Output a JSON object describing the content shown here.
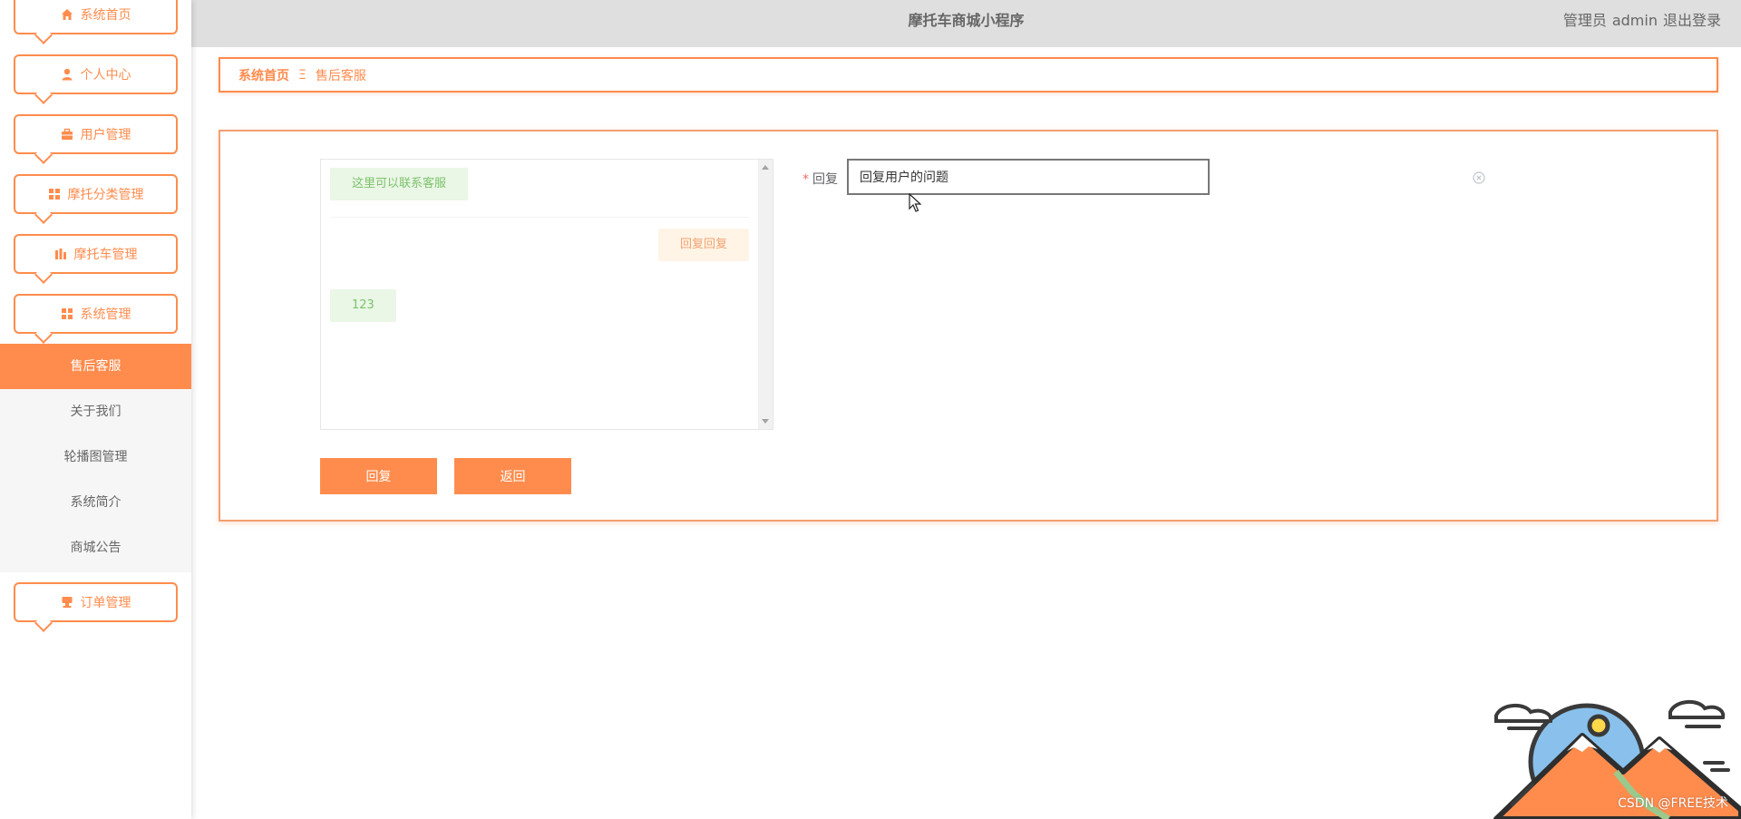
{
  "app": {
    "title": "摩托车商城小程序",
    "user_role": "管理员",
    "user_name": "admin",
    "logout_label": "退出登录"
  },
  "sidebar": {
    "menus": [
      {
        "label": "系统首页",
        "icon": "home-icon"
      },
      {
        "label": "个人中心",
        "icon": "user-icon"
      },
      {
        "label": "用户管理",
        "icon": "briefcase-icon"
      },
      {
        "label": "摩托分类管理",
        "icon": "grid-icon"
      },
      {
        "label": "摩托车管理",
        "icon": "chart-icon"
      },
      {
        "label": "系统管理",
        "icon": "grid-icon"
      },
      {
        "label": "订单管理",
        "icon": "stamp-icon"
      }
    ],
    "submenu": [
      {
        "label": "售后客服",
        "active": true
      },
      {
        "label": "关于我们",
        "active": false
      },
      {
        "label": "轮播图管理",
        "active": false
      },
      {
        "label": "系统简介",
        "active": false
      },
      {
        "label": "商城公告",
        "active": false
      }
    ]
  },
  "breadcrumb": {
    "home": "系统首页",
    "separator": "Ξ",
    "current": "售后客服"
  },
  "chat": {
    "messages": [
      {
        "text": "这里可以联系客服",
        "side": "left"
      },
      {
        "text": "回复回复",
        "side": "right"
      },
      {
        "text": "123",
        "side": "left"
      }
    ]
  },
  "form": {
    "reply_label": "回复",
    "required_mark": "*",
    "reply_value": "回复用户的问题"
  },
  "buttons": {
    "reply": "回复",
    "back": "返回"
  },
  "watermark": "CSDN @FREE技术",
  "colors": {
    "accent": "#ff8c4d",
    "header_bg": "#e0dfe0",
    "chat_left_bg": "#eaf6e6",
    "chat_left_text": "#7cc36a",
    "chat_right_bg": "#fff4e6",
    "chat_right_text": "#f2a270"
  }
}
